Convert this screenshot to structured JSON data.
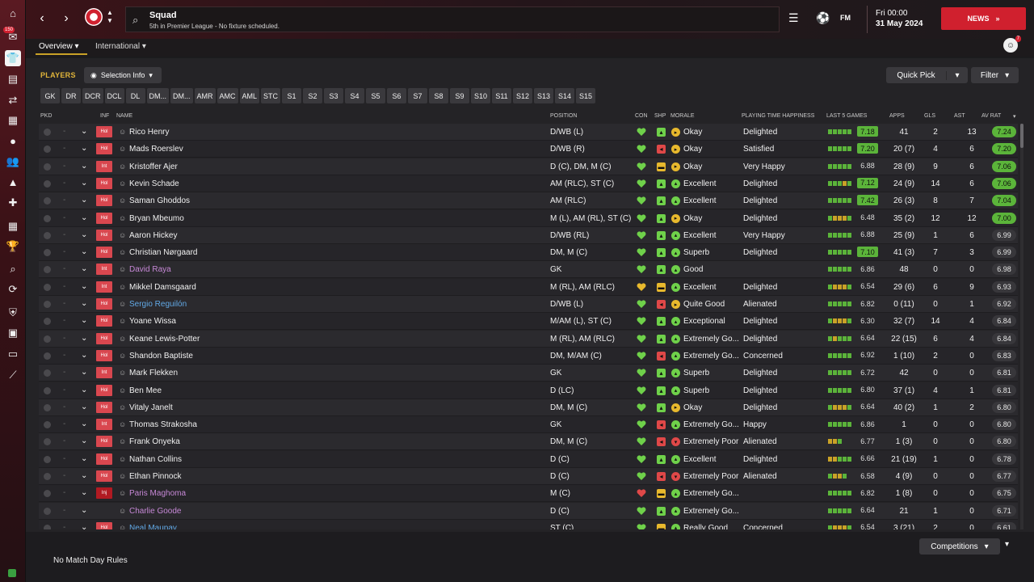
{
  "header": {
    "title": "Squad",
    "subtitle": "5th in Premier League - No fixture scheduled.",
    "fm_logo": "FM",
    "day_time": "Fri 00:00",
    "date": "31 May 2024",
    "news_label": "NEWS",
    "news_icon": "double-chevron-right-icon"
  },
  "sidebar": {
    "badge": "150",
    "items": [
      "home-icon",
      "inbox-icon",
      "squad-icon",
      "dynamics-icon",
      "scouting-icon",
      "reports-icon",
      "tactics-icon",
      "staff-icon",
      "training-icon",
      "medical-icon",
      "schedule-icon",
      "competitions-icon",
      "search-icon",
      "transfer-icon",
      "club-icon",
      "finances-icon",
      "tv-icon",
      "stats-icon"
    ]
  },
  "subtabs": {
    "overview": "Overview",
    "international": "International"
  },
  "user": {
    "badge": "7"
  },
  "toolbar": {
    "players_label": "PLAYERS",
    "selection_info": "Selection Info",
    "quick_pick": "Quick Pick",
    "filter": "Filter"
  },
  "positions": [
    "GK",
    "DR",
    "DCR",
    "DCL",
    "DL",
    "DM...",
    "DM...",
    "AMR",
    "AMC",
    "AML",
    "STC",
    "S1",
    "S2",
    "S3",
    "S4",
    "S5",
    "S6",
    "S7",
    "S8",
    "S9",
    "S10",
    "S11",
    "S12",
    "S13",
    "S14",
    "S15"
  ],
  "columns": {
    "pkd": "PKD",
    "inf": "INF",
    "name": "NAME",
    "position": "POSITION",
    "con": "CON",
    "shp": "SHP",
    "morale": "MORALE",
    "pth": "PLAYING TIME HAPPINESS",
    "last5": "LAST 5 GAMES",
    "apps": "APPS",
    "gls": "GLS",
    "ast": "AST",
    "avrat": "AV RAT"
  },
  "players": [
    {
      "inf": "Hol",
      "name": "Rico Henry",
      "style": "normal",
      "position": "D/WB (L)",
      "con": "green",
      "shp": "green",
      "morale": "Okay",
      "md": "yellow",
      "pth": "Delighted",
      "last5": "ggggg",
      "last_rating": "7.18",
      "last_good": true,
      "apps": "41",
      "gls": "2",
      "ast": "13",
      "avrat": "7.24",
      "av_good": true
    },
    {
      "inf": "Hol",
      "name": "Mads Roerslev",
      "style": "normal",
      "position": "D/WB (R)",
      "con": "green",
      "shp": "red",
      "morale": "Okay",
      "md": "yellow",
      "pth": "Satisfied",
      "last5": "ggggg",
      "last_rating": "7.20",
      "last_good": true,
      "apps": "20 (7)",
      "gls": "4",
      "ast": "6",
      "avrat": "7.20",
      "av_good": true
    },
    {
      "inf": "Int",
      "name": "Kristoffer Ajer",
      "style": "normal",
      "position": "D (C), DM, M (C)",
      "con": "green",
      "shp": "yellow",
      "morale": "Okay",
      "md": "yellow",
      "pth": "Very Happy",
      "last5": "ggggg",
      "last_rating": "6.88",
      "last_good": false,
      "apps": "28 (9)",
      "gls": "9",
      "ast": "6",
      "avrat": "7.06",
      "av_good": true
    },
    {
      "inf": "Hol",
      "name": "Kevin Schade",
      "style": "normal",
      "position": "AM (RLC), ST (C)",
      "con": "green",
      "shp": "green",
      "morale": "Excellent",
      "md": "green",
      "pth": "Delighted",
      "last5": "gggyg",
      "last_rating": "7.12",
      "last_good": true,
      "apps": "24 (9)",
      "gls": "14",
      "ast": "6",
      "avrat": "7.06",
      "av_good": true
    },
    {
      "inf": "Hol",
      "name": "Saman Ghoddos",
      "style": "normal",
      "position": "AM (RLC)",
      "con": "green",
      "shp": "green",
      "morale": "Excellent",
      "md": "green",
      "pth": "Delighted",
      "last5": "ggggg",
      "last_rating": "7.42",
      "last_good": true,
      "apps": "26 (3)",
      "gls": "8",
      "ast": "7",
      "avrat": "7.04",
      "av_good": true
    },
    {
      "inf": "Hol",
      "name": "Bryan Mbeumo",
      "style": "normal",
      "position": "M (L), AM (RL), ST (C)",
      "con": "green",
      "shp": "green",
      "morale": "Okay",
      "md": "yellow",
      "pth": "Delighted",
      "last5": "gyyyg",
      "last_rating": "6.48",
      "last_good": false,
      "apps": "35 (2)",
      "gls": "12",
      "ast": "12",
      "avrat": "7.00",
      "av_good": true
    },
    {
      "inf": "Hol",
      "name": "Aaron Hickey",
      "style": "normal",
      "position": "D/WB (RL)",
      "con": "green",
      "shp": "green",
      "morale": "Excellent",
      "md": "green",
      "pth": "Very Happy",
      "last5": "ggggg",
      "last_rating": "6.88",
      "last_good": false,
      "apps": "25 (9)",
      "gls": "1",
      "ast": "6",
      "avrat": "6.99",
      "av_good": false
    },
    {
      "inf": "Hol",
      "name": "Christian Nørgaard",
      "style": "normal",
      "position": "DM, M (C)",
      "con": "green",
      "shp": "green",
      "morale": "Superb",
      "md": "green",
      "pth": "Delighted",
      "last5": "ggggg",
      "last_rating": "7.10",
      "last_good": true,
      "apps": "41 (3)",
      "gls": "7",
      "ast": "3",
      "avrat": "6.99",
      "av_good": false
    },
    {
      "inf": "Int",
      "name": "David Raya",
      "style": "loan",
      "position": "GK",
      "con": "green",
      "shp": "green",
      "morale": "Good",
      "md": "green",
      "pth": "",
      "last5": "ggggg",
      "last_rating": "6.86",
      "last_good": false,
      "apps": "48",
      "gls": "0",
      "ast": "0",
      "avrat": "6.98",
      "av_good": false
    },
    {
      "inf": "Int",
      "name": "Mikkel Damsgaard",
      "style": "normal",
      "position": "M (RL), AM (RLC)",
      "con": "yellow",
      "shp": "yellow",
      "morale": "Excellent",
      "md": "green",
      "pth": "Delighted",
      "last5": "gyyyg",
      "last_rating": "6.54",
      "last_good": false,
      "apps": "29 (6)",
      "gls": "6",
      "ast": "9",
      "avrat": "6.93",
      "av_good": false
    },
    {
      "inf": "Hol",
      "name": "Sergio Reguilón",
      "style": "blue",
      "position": "D/WB (L)",
      "con": "green",
      "shp": "red",
      "morale": "Quite Good",
      "md": "yellow",
      "pth": "Alienated",
      "last5": "ggggg",
      "last_rating": "6.82",
      "last_good": false,
      "apps": "0 (11)",
      "gls": "0",
      "ast": "1",
      "avrat": "6.92",
      "av_good": false
    },
    {
      "inf": "Hol",
      "name": "Yoane Wissa",
      "style": "normal",
      "position": "M/AM (L), ST (C)",
      "con": "green",
      "shp": "green",
      "morale": "Exceptional",
      "md": "green",
      "pth": "Delighted",
      "last5": "gyyyg",
      "last_rating": "6.30",
      "last_good": false,
      "apps": "32 (7)",
      "gls": "14",
      "ast": "4",
      "avrat": "6.84",
      "av_good": false
    },
    {
      "inf": "Hol",
      "name": "Keane Lewis-Potter",
      "style": "normal",
      "position": "M (RL), AM (RLC)",
      "con": "green",
      "shp": "green",
      "morale": "Extremely Go...",
      "md": "green",
      "pth": "Delighted",
      "last5": "gyggg",
      "last_rating": "6.64",
      "last_good": false,
      "apps": "22 (15)",
      "gls": "6",
      "ast": "4",
      "avrat": "6.84",
      "av_good": false
    },
    {
      "inf": "Hol",
      "name": "Shandon Baptiste",
      "style": "normal",
      "position": "DM, M/AM (C)",
      "con": "green",
      "shp": "red",
      "morale": "Extremely Go...",
      "md": "green",
      "pth": "Concerned",
      "last5": "ggggg",
      "last_rating": "6.92",
      "last_good": false,
      "apps": "1 (10)",
      "gls": "2",
      "ast": "0",
      "avrat": "6.83",
      "av_good": false
    },
    {
      "inf": "Int",
      "name": "Mark Flekken",
      "style": "normal",
      "position": "GK",
      "con": "green",
      "shp": "green",
      "morale": "Superb",
      "md": "green",
      "pth": "Delighted",
      "last5": "ggggg",
      "last_rating": "6.72",
      "last_good": false,
      "apps": "42",
      "gls": "0",
      "ast": "0",
      "avrat": "6.81",
      "av_good": false
    },
    {
      "inf": "Hol",
      "name": "Ben Mee",
      "style": "normal",
      "position": "D (LC)",
      "con": "green",
      "shp": "green",
      "morale": "Superb",
      "md": "green",
      "pth": "Delighted",
      "last5": "ggggg",
      "last_rating": "6.80",
      "last_good": false,
      "apps": "37 (1)",
      "gls": "4",
      "ast": "1",
      "avrat": "6.81",
      "av_good": false
    },
    {
      "inf": "Hol",
      "name": "Vitaly Janelt",
      "style": "normal",
      "position": "DM, M (C)",
      "con": "green",
      "shp": "green",
      "morale": "Okay",
      "md": "yellow",
      "pth": "Delighted",
      "last5": "gyyyg",
      "last_rating": "6.64",
      "last_good": false,
      "apps": "40 (2)",
      "gls": "1",
      "ast": "2",
      "avrat": "6.80",
      "av_good": false
    },
    {
      "inf": "Int",
      "name": "Thomas Strakosha",
      "style": "normal",
      "position": "GK",
      "con": "green",
      "shp": "red",
      "morale": "Extremely Go...",
      "md": "green",
      "pth": "Happy",
      "last5": "ggggg",
      "last_rating": "6.86",
      "last_good": false,
      "apps": "1",
      "gls": "0",
      "ast": "0",
      "avrat": "6.80",
      "av_good": false
    },
    {
      "inf": "Hol",
      "name": "Frank Onyeka",
      "style": "normal",
      "position": "DM, M (C)",
      "con": "green",
      "shp": "red",
      "morale": "Extremely Poor",
      "md": "red",
      "pth": "Alienated",
      "last5": "yyg",
      "last_rating": "6.77",
      "last_good": false,
      "apps": "1 (3)",
      "gls": "0",
      "ast": "0",
      "avrat": "6.80",
      "av_good": false
    },
    {
      "inf": "Hol",
      "name": "Nathan Collins",
      "style": "normal",
      "position": "D (C)",
      "con": "green",
      "shp": "green",
      "morale": "Excellent",
      "md": "green",
      "pth": "Delighted",
      "last5": "yyggg",
      "last_rating": "6.66",
      "last_good": false,
      "apps": "21 (19)",
      "gls": "1",
      "ast": "0",
      "avrat": "6.78",
      "av_good": false
    },
    {
      "inf": "Hol",
      "name": "Ethan Pinnock",
      "style": "normal",
      "position": "D (C)",
      "con": "green",
      "shp": "red",
      "morale": "Extremely Poor",
      "md": "red",
      "pth": "Alienated",
      "last5": "gyyg",
      "last_rating": "6.58",
      "last_good": false,
      "apps": "4 (9)",
      "gls": "0",
      "ast": "0",
      "avrat": "6.77",
      "av_good": false
    },
    {
      "inf": "Inj",
      "name": "Paris Maghoma",
      "style": "loan",
      "position": "M (C)",
      "con": "red",
      "shp": "yellow",
      "morale": "Extremely Go...",
      "md": "green",
      "pth": "",
      "last5": "ggggg",
      "last_rating": "6.82",
      "last_good": false,
      "apps": "1 (8)",
      "gls": "0",
      "ast": "0",
      "avrat": "6.75",
      "av_good": false
    },
    {
      "inf": "",
      "name": "Charlie Goode",
      "style": "loan",
      "position": "D (C)",
      "con": "green",
      "shp": "green",
      "morale": "Extremely Go...",
      "md": "green",
      "pth": "",
      "last5": "ggggg",
      "last_rating": "6.64",
      "last_good": false,
      "apps": "21",
      "gls": "1",
      "ast": "0",
      "avrat": "6.71",
      "av_good": false
    },
    {
      "inf": "Hol",
      "name": "Neal Maupay",
      "style": "blue",
      "position": "ST (C)",
      "con": "green",
      "shp": "yellow",
      "morale": "Really Good",
      "md": "green",
      "pth": "Concerned",
      "last5": "gyyyg",
      "last_rating": "6.54",
      "last_good": false,
      "apps": "3 (21)",
      "gls": "2",
      "ast": "0",
      "avrat": "6.61",
      "av_good": false
    }
  ],
  "footer": {
    "rules": "No Match Day Rules",
    "competitions": "Competitions"
  }
}
